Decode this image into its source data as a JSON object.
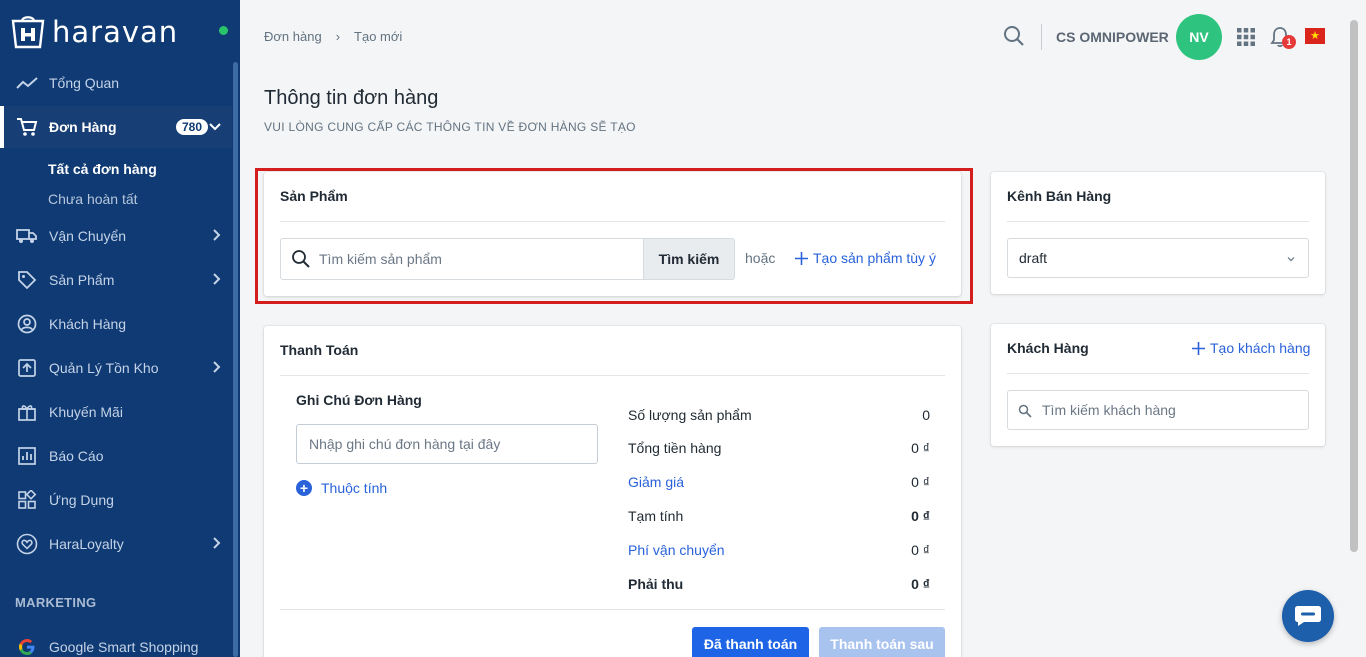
{
  "sidebar": {
    "brand": "haravan",
    "nav": [
      {
        "label": "Tổng Quan",
        "icon": "trend-line-icon"
      },
      {
        "label": "Đơn Hàng",
        "icon": "cart-icon",
        "badge": "780"
      },
      {
        "label": "Vận Chuyển",
        "icon": "truck-icon"
      },
      {
        "label": "Sản Phẩm",
        "icon": "tag-icon"
      },
      {
        "label": "Khách Hàng",
        "icon": "user-circle-icon"
      },
      {
        "label": "Quản Lý Tồn Kho",
        "icon": "inventory-icon"
      },
      {
        "label": "Khuyến Mãi",
        "icon": "promotion-icon"
      },
      {
        "label": "Báo Cáo",
        "icon": "report-icon"
      },
      {
        "label": "Ứng Dụng",
        "icon": "apps-icon"
      },
      {
        "label": "HaraLoyalty",
        "icon": "heart-icon"
      }
    ],
    "orders_sub": [
      "Tất cả đơn hàng",
      "Chưa hoàn tất"
    ],
    "marketing_title": "MARKETING",
    "marketing_items": [
      {
        "label": "Google Smart Shopping",
        "icon": "google-icon"
      }
    ]
  },
  "header": {
    "breadcrumb": [
      "Đơn hàng",
      "Tạo mới"
    ],
    "store_name": "CS OMNIPOWER",
    "avatar_initials": "NV",
    "notification_count": "1",
    "flag_star": "★"
  },
  "page": {
    "title": "Thông tin đơn hàng",
    "subtitle": "VUI LÒNG CUNG CẤP CÁC THÔNG TIN VỀ ĐƠN HÀNG SẼ TẠO"
  },
  "products_card": {
    "title": "Sản Phẩm",
    "search_placeholder": "Tìm kiếm sản phẩm",
    "search_button": "Tìm kiếm",
    "or_text": "hoặc",
    "custom_product_link": "Tạo sản phẩm tùy ý"
  },
  "channel_card": {
    "title": "Kênh Bán Hàng",
    "selected": "draft"
  },
  "customer_card": {
    "title": "Khách Hàng",
    "create_link": "Tạo khách hàng",
    "search_placeholder": "Tìm kiếm khách hàng"
  },
  "payment_card": {
    "title": "Thanh Toán",
    "note_title": "Ghi Chú Đơn Hàng",
    "note_placeholder": "Nhập ghi chú đơn hàng tại đây",
    "attribute_link": "Thuộc tính",
    "summary": [
      {
        "label": "Số lượng sản phẩm",
        "value": "0"
      },
      {
        "label": "Tổng tiền hàng",
        "value": "0 ₫"
      },
      {
        "label": "Giảm giá",
        "value": "0 ₫"
      },
      {
        "label": "Tạm tính",
        "value": "0 ₫"
      },
      {
        "label": "Phí vận chuyển",
        "value": "0 ₫"
      },
      {
        "label": "Phải thu",
        "value": "0 ₫"
      }
    ],
    "paid_button": "Đã thanh toán",
    "pay_later_button": "Thanh toán sau"
  },
  "colors": {
    "sidebar_bg": "#0f3a73",
    "accent_blue": "#2962d9",
    "primary_button": "#1d64e6",
    "avatar_green": "#2ec47f",
    "highlight_red": "#d41d1d"
  }
}
